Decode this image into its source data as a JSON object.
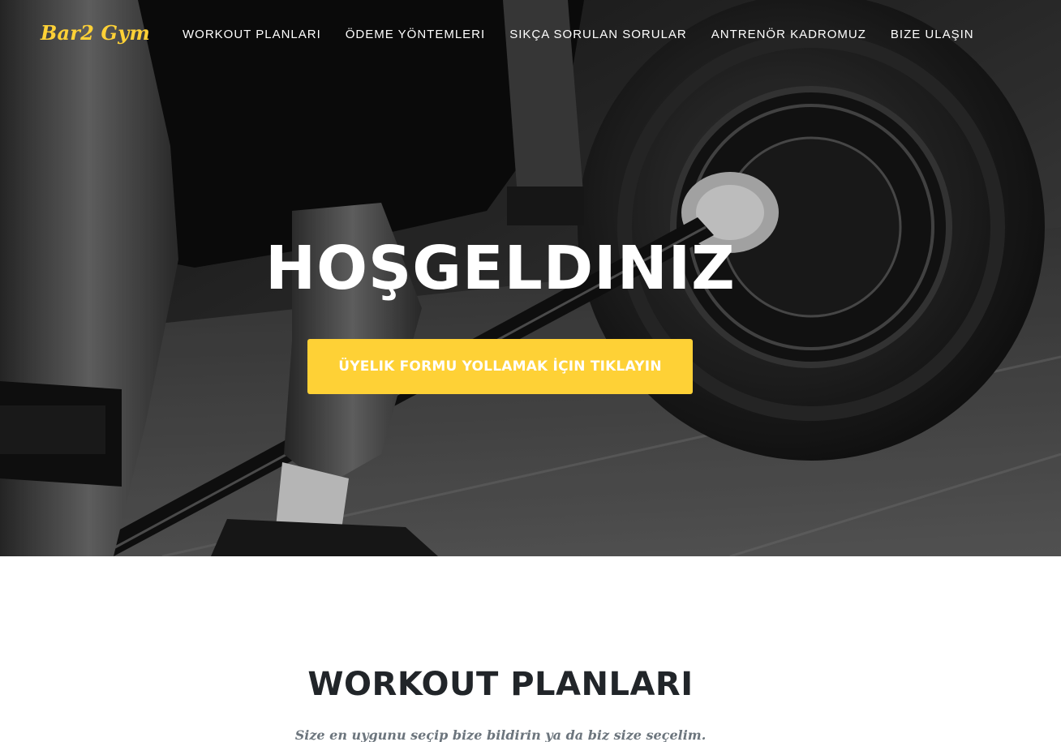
{
  "brand": {
    "name": "Bar2 Gym",
    "color": "#fed136"
  },
  "nav": {
    "items": [
      "WORKOUT PLANLARI",
      "ÖDEME YÖNTEMLERI",
      "SIKÇA SORULAN SORULAR",
      "ANTRENÖR KADROMUZ",
      "BIZE ULAŞIN"
    ]
  },
  "hero": {
    "heading": "HOŞGELDINIZ",
    "cta_label": "ÜYELIK FORMU YOLLAMAK İÇIN TIKLAYIN",
    "cta_color": "#fed136",
    "image_icon": "barbell-deadlift-photo"
  },
  "workouts": {
    "heading": "WORKOUT PLANLARI",
    "subheading": "Size en uygunu seçip bize bildirin ya da biz size seçelim."
  }
}
